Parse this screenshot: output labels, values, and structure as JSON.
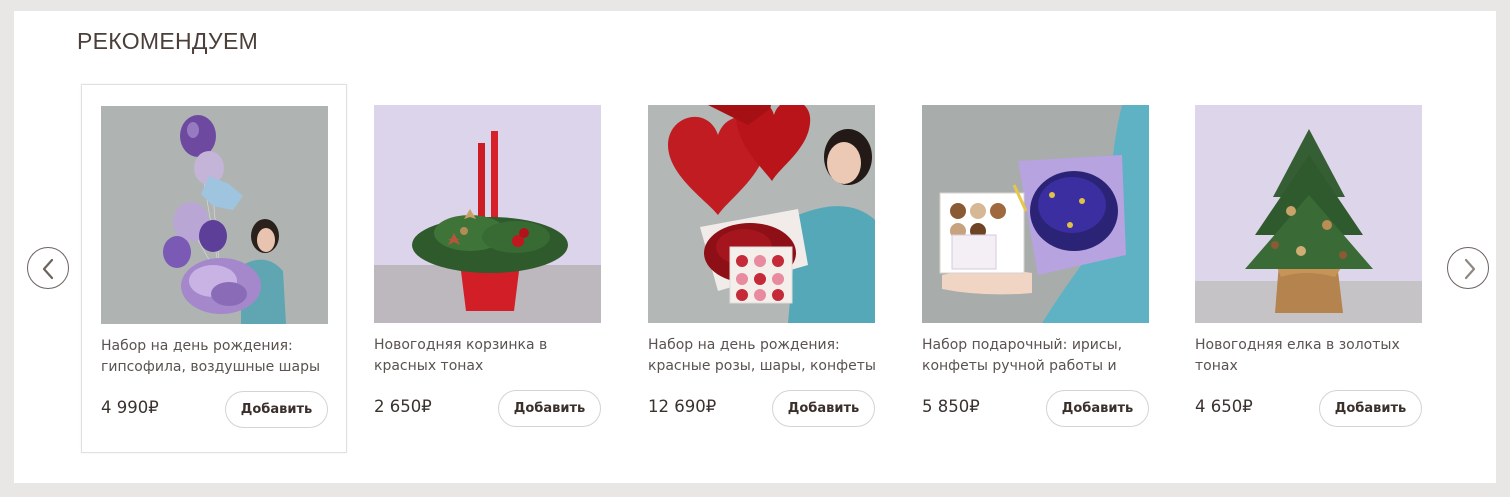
{
  "section": {
    "title": "РЕКОМЕНДУЕМ"
  },
  "carousel": {
    "prev_icon": "chevron-left-icon",
    "next_icon": "chevron-right-icon"
  },
  "currency": "₽",
  "products": [
    {
      "name": "Набор на день рождения: гипсофила, воздушные шары",
      "price": "4 990₽",
      "button": "Добавить"
    },
    {
      "name": "Новогодняя корзинка в красных тонах",
      "price": "2 650₽",
      "button": "Добавить"
    },
    {
      "name": "Набор на день рождения: красные розы, шары, конфеты",
      "price": "12 690₽",
      "button": "Добавить"
    },
    {
      "name": "Набор подарочный: ирисы, конфеты ручной работы и",
      "price": "5 850₽",
      "button": "Добавить"
    },
    {
      "name": "Новогодняя елка в золотых тонах",
      "price": "4 650₽",
      "button": "Добавить"
    }
  ]
}
